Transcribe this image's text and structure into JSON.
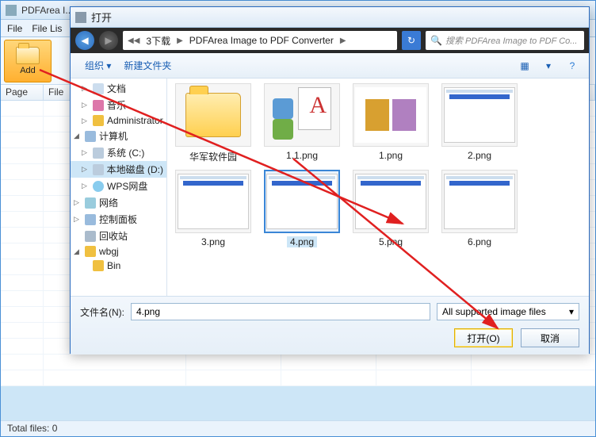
{
  "app": {
    "title": "PDFArea I...",
    "menu": {
      "file": "File",
      "filelist": "File Lis"
    },
    "add_label": "Add",
    "grid": {
      "col_page": "Page",
      "col_file": "File"
    },
    "status": "Total files: 0"
  },
  "dialog": {
    "title": "打开",
    "path": {
      "seg1": "3下载",
      "seg2": "PDFArea Image to PDF Converter"
    },
    "search_placeholder": "搜索 PDFArea Image to PDF Co...",
    "toolbar": {
      "organize": "组织 ▾",
      "newfolder": "新建文件夹"
    },
    "tree": [
      {
        "label": "文档",
        "icon": "doc",
        "lvl": 1,
        "expand": "▷"
      },
      {
        "label": "音乐",
        "icon": "music",
        "lvl": 1,
        "expand": "▷"
      },
      {
        "label": "Administrator",
        "icon": "folder",
        "lvl": 1,
        "expand": "▷"
      },
      {
        "label": "计算机",
        "icon": "cp",
        "lvl": 0,
        "expand": "◢"
      },
      {
        "label": "系统 (C:)",
        "icon": "disk",
        "lvl": 1,
        "expand": "▷"
      },
      {
        "label": "本地磁盘 (D:)",
        "icon": "disk",
        "lvl": 1,
        "expand": "▷",
        "sel": true
      },
      {
        "label": "WPS网盘",
        "icon": "cloud",
        "lvl": 1,
        "expand": "▷"
      },
      {
        "label": "网络",
        "icon": "net",
        "lvl": 0,
        "expand": "▷"
      },
      {
        "label": "控制面板",
        "icon": "cp",
        "lvl": 0,
        "expand": "▷"
      },
      {
        "label": "回收站",
        "icon": "bin",
        "lvl": 0,
        "expand": ""
      },
      {
        "label": "wbgj",
        "icon": "folder",
        "lvl": 0,
        "expand": "◢"
      },
      {
        "label": "Bin",
        "icon": "folder",
        "lvl": 1,
        "expand": ""
      }
    ],
    "files": [
      {
        "name": "华军软件园",
        "kind": "folder"
      },
      {
        "name": "1.1.png",
        "kind": "pdf"
      },
      {
        "name": "1.png",
        "kind": "two"
      },
      {
        "name": "2.png",
        "kind": "shot"
      },
      {
        "name": "3.png",
        "kind": "shot"
      },
      {
        "name": "4.png",
        "kind": "shot",
        "sel": true
      },
      {
        "name": "5.png",
        "kind": "shot"
      },
      {
        "name": "6.png",
        "kind": "shot"
      }
    ],
    "filename_label": "文件名(N):",
    "filename_value": "4.png",
    "filter": "All supported image files",
    "open_btn": "打开(O)",
    "cancel_btn": "取消"
  }
}
